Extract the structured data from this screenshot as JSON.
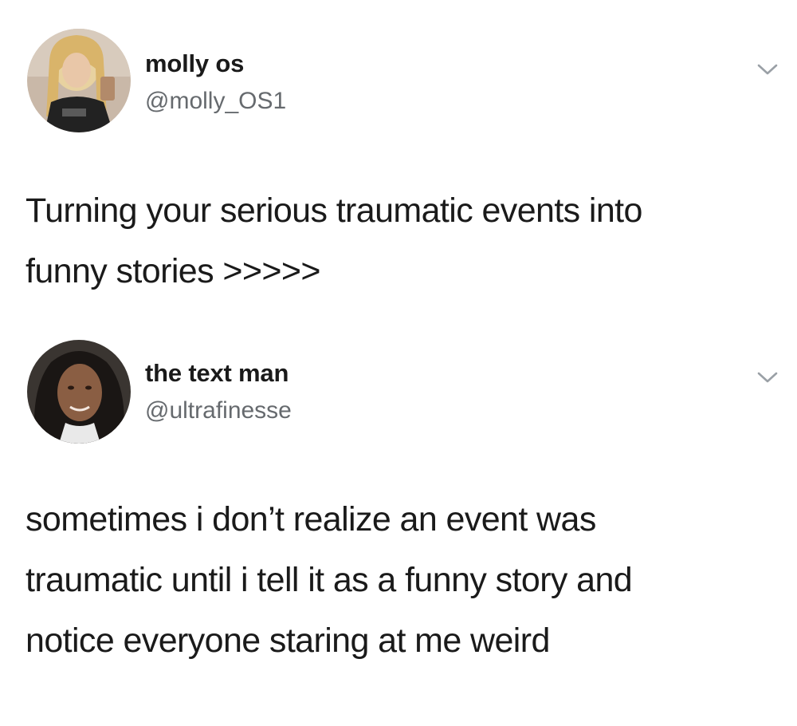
{
  "tweets": [
    {
      "display_name": "molly os",
      "handle": "@molly_OS1",
      "text": "Turning your serious traumatic events into\nfunny stories >>>>>",
      "avatar_icon": "avatar-photo-molly",
      "menu_icon": "chevron-down-icon"
    },
    {
      "display_name": "the text man",
      "handle": "@ultrafinesse",
      "text": "sometimes i don’t realize an event was\ntraumatic until i tell it as a funny story and\nnotice everyone staring at me weird",
      "avatar_icon": "avatar-photo-ultrafinesse",
      "menu_icon": "chevron-down-icon"
    }
  ],
  "colors": {
    "text": "#1a1a1a",
    "handle": "#666a6e",
    "chevron": "#9aa0a6",
    "background": "#ffffff"
  }
}
